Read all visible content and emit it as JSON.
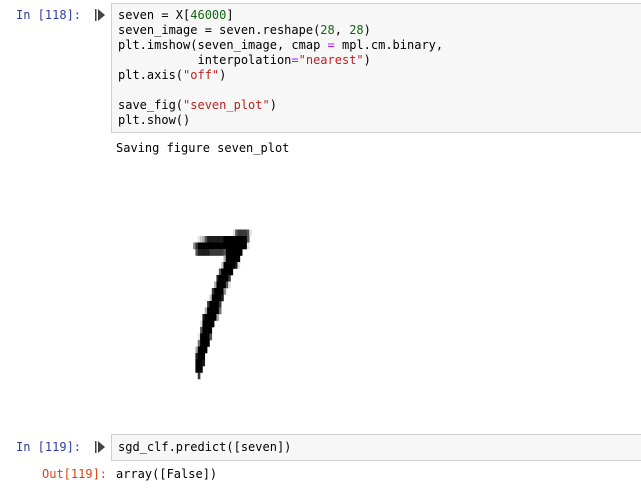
{
  "cells": [
    {
      "prompt": "In [118]:",
      "code_lines": [
        [
          {
            "t": "seven = X["
          },
          {
            "t": "46000",
            "c": "cm-num"
          },
          {
            "t": "]"
          }
        ],
        [
          {
            "t": "seven_image = seven.reshape("
          },
          {
            "t": "28",
            "c": "cm-num"
          },
          {
            "t": ", "
          },
          {
            "t": "28",
            "c": "cm-num"
          },
          {
            "t": ")"
          }
        ],
        [
          {
            "t": "plt.imshow(seven_image, cmap "
          },
          {
            "t": "=",
            "c": "cm-kw"
          },
          {
            "t": " mpl.cm.binary,"
          }
        ],
        [
          {
            "t": "           interpolation"
          },
          {
            "t": "=",
            "c": "cm-kw"
          },
          {
            "t": "\"nearest\"",
            "c": "cm-str"
          },
          {
            "t": ")"
          }
        ],
        [
          {
            "t": "plt.axis("
          },
          {
            "t": "\"off\"",
            "c": "cm-str"
          },
          {
            "t": ")"
          }
        ],
        [
          {
            "t": ""
          }
        ],
        [
          {
            "t": "save_fig("
          },
          {
            "t": "\"seven_plot\"",
            "c": "cm-str"
          },
          {
            "t": ")"
          }
        ],
        [
          {
            "t": "plt.show()"
          }
        ]
      ],
      "output_text": "Saving figure seven_plot"
    },
    {
      "prompt": "In [119]:",
      "code_lines": [
        [
          {
            "t": "sgd_clf.predict(["
          },
          {
            "t": "seven"
          },
          {
            "t": "])"
          }
        ]
      ],
      "out_prompt": "Out[119]:",
      "output_text": "array([False])"
    }
  ],
  "digit_image": {
    "description_icon": "mnist-digit-seven-plot",
    "rows": [
      "......................................",
      "..........................16777761....",
      "...........1236888888899999999996.....",
      ".........479999999999999999999991.....",
      "..........68888877777769999999........",
      "......................3999999.........",
      ".....................29999981.........",
      "....................699999............",
      "...................899997.............",
      "..................3999961.............",
      ".................799994...............",
      "................299998................",
      "...............799997.................",
      "..............3999995.................",
      ".............8999993..................",
      "............199999....................",
      "............69999.....................",
      "...........199996.....................",
      "...........59999......................",
      "..........39999.......................",
      "..........8999........................",
      "..........9998........................",
      "..........999.........................",
      "...........7.........................."
    ]
  }
}
